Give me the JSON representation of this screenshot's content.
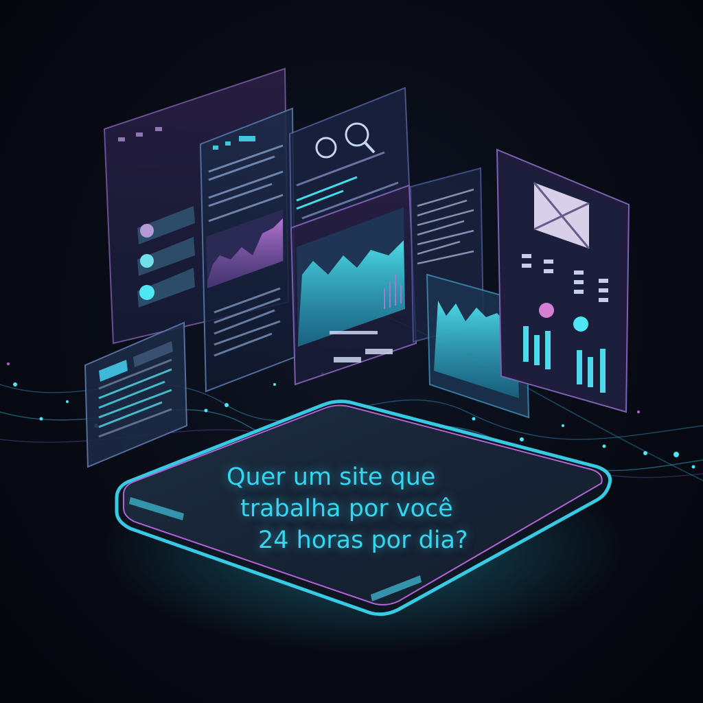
{
  "headline": {
    "line1": "Quer um site que",
    "line2": "trabalha por você",
    "line3": "24 horas por dia?"
  },
  "colors": {
    "background": "#05070d",
    "accent_cyan": "#35d6f0",
    "accent_purple": "#b463d6",
    "panel_fill": "#1b2240"
  }
}
